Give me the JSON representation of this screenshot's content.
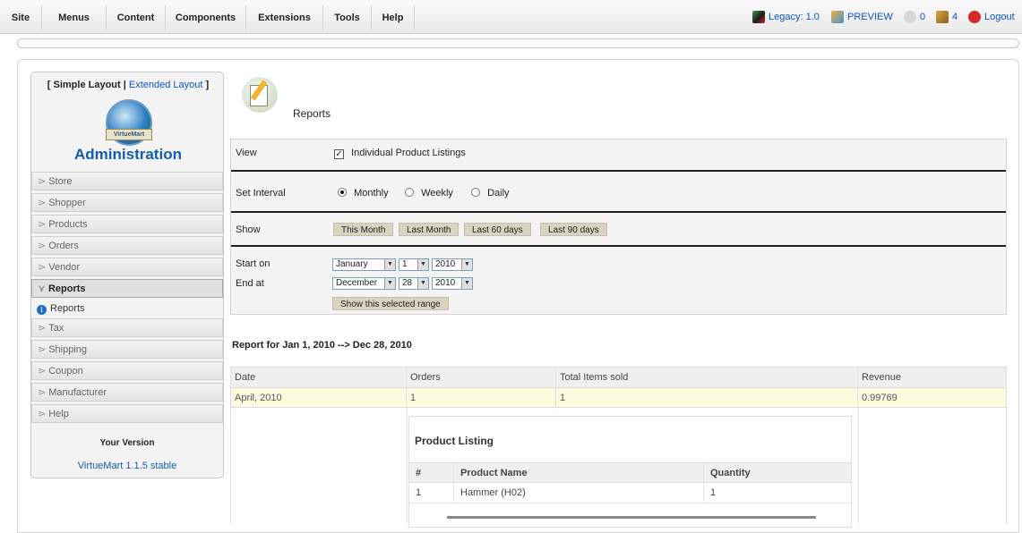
{
  "menubar": {
    "items": [
      "Site",
      "Menus",
      "Content",
      "Components",
      "Extensions",
      "Tools",
      "Help"
    ],
    "status": {
      "legacy": "Legacy: 1.0",
      "preview": "PREVIEW",
      "messages": "0",
      "users": "4",
      "logout": "Logout"
    }
  },
  "sidebar": {
    "layout_current": "[ Simple Layout |",
    "layout_link": "Extended Layout",
    "layout_close": "]",
    "logo_text": "VirtueMart",
    "title": "Administration",
    "nav_items": [
      "Store",
      "Shopper",
      "Products",
      "Orders",
      "Vendor",
      "Reports",
      "Tax",
      "Shipping",
      "Coupon",
      "Manufacturer",
      "Help"
    ],
    "sub_item": "Reports",
    "version_label": "Your Version",
    "version_value": "VirtueMart 1.1.5 stable"
  },
  "page": {
    "heading": "Reports"
  },
  "form": {
    "view_label": "View",
    "view_checkbox": "Individual Product Listings",
    "interval_label": "Set Interval",
    "interval_options": [
      "Monthly",
      "Weekly",
      "Daily"
    ],
    "interval_selected": "Monthly",
    "show_label": "Show",
    "show_buttons": [
      "This Month",
      "Last Month",
      "Last 60 days",
      "Last 90 days"
    ],
    "start_label": "Start on",
    "start_month": "January",
    "start_day": "1",
    "start_year": "2010",
    "end_label": "End at",
    "end_month": "December",
    "end_day": "28",
    "end_year": "2010",
    "range_button": "Show this selected range"
  },
  "report": {
    "heading": "Report for Jan 1, 2010 --> Dec 28, 2010",
    "columns": [
      "Date",
      "Orders",
      "Total Items sold",
      "Revenue"
    ],
    "rows": [
      [
        "April, 2010",
        "1",
        "1",
        "0.99769"
      ]
    ],
    "product_listing": {
      "title": "Product Listing",
      "columns": [
        "#",
        "Product Name",
        "Quantity"
      ],
      "rows": [
        [
          "1",
          "Hammer (H02)",
          "1"
        ]
      ]
    }
  }
}
